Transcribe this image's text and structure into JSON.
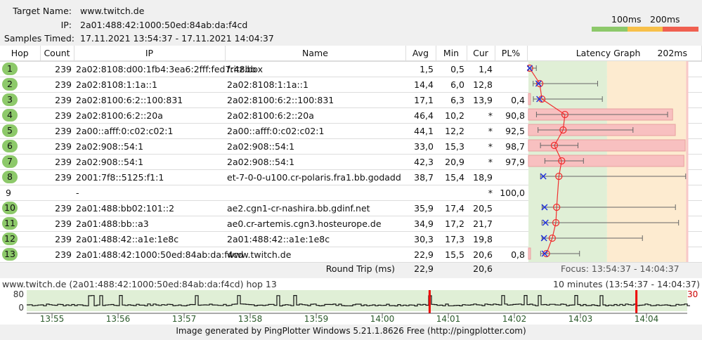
{
  "header": {
    "target_label": "Target Name:",
    "target": "www.twitch.de",
    "ip_label": "IP:",
    "ip": "2a01:488:42:1000:50ed:84ab:da:f4cd",
    "samples_label": "Samples Timed:",
    "samples": "17.11.2021 13:54:37 - 17.11.2021 14:04:37"
  },
  "legend": {
    "l1": "100ms",
    "l2": "200ms",
    "colors": [
      "#8dc96a",
      "#f8c04a",
      "#f06050"
    ]
  },
  "columns": {
    "hop": "Hop",
    "count": "Count",
    "ip": "IP",
    "name": "Name",
    "avg": "Avg",
    "min": "Min",
    "cur": "Cur",
    "pl": "PL%",
    "graph": "Latency Graph",
    "scale": "202ms"
  },
  "hops": [
    {
      "hop": "1",
      "count": "239",
      "ip": "2a02:8108:d00:1fb4:3ea6:2fff:fed7:48bb",
      "name": "fritz.box",
      "avg": "1,5",
      "min": "0,5",
      "cur": "1,4",
      "pl": "",
      "a": 1.5,
      "mn": 0.5,
      "c": 1.4,
      "mx": 10,
      "p": 0
    },
    {
      "hop": "2",
      "count": "239",
      "ip": "2a02:8108:1:1a::1",
      "name": "2a02:8108:1:1a::1",
      "avg": "14,4",
      "min": "6,0",
      "cur": "12,8",
      "pl": "",
      "a": 14.4,
      "mn": 6,
      "c": 12.8,
      "mx": 88,
      "p": 0
    },
    {
      "hop": "3",
      "count": "239",
      "ip": "2a02:8100:6:2::100:831",
      "name": "2a02:8100:6:2::100:831",
      "avg": "17,1",
      "min": "6,3",
      "cur": "13,9",
      "pl": "0,4",
      "a": 17.1,
      "mn": 6.3,
      "c": 13.9,
      "mx": 94,
      "p": 0.4
    },
    {
      "hop": "4",
      "count": "239",
      "ip": "2a02:8100:6:2::20a",
      "name": "2a02:8100:6:2::20a",
      "avg": "46,4",
      "min": "10,2",
      "cur": "*",
      "pl": "90,8",
      "a": 46.4,
      "mn": 10.2,
      "c": null,
      "mx": 177,
      "p": 90.8
    },
    {
      "hop": "5",
      "count": "239",
      "ip": "2a00::afff:0:c02:c02:1",
      "name": "2a00::afff:0:c02:c02:1",
      "avg": "44,1",
      "min": "12,2",
      "cur": "*",
      "pl": "92,5",
      "a": 44.1,
      "mn": 12.2,
      "c": null,
      "mx": 133,
      "p": 92.5
    },
    {
      "hop": "6",
      "count": "239",
      "ip": "2a02:908::54:1",
      "name": "2a02:908::54:1",
      "avg": "33,0",
      "min": "15,3",
      "cur": "*",
      "pl": "98,7",
      "a": 33,
      "mn": 15.3,
      "c": null,
      "mx": 63,
      "p": 98.7
    },
    {
      "hop": "7",
      "count": "239",
      "ip": "2a02:908::54:1",
      "name": "2a02:908::54:1",
      "avg": "42,3",
      "min": "20,9",
      "cur": "*",
      "pl": "97,9",
      "a": 42.3,
      "mn": 20.9,
      "c": null,
      "mx": 70,
      "p": 97.9
    },
    {
      "hop": "8",
      "count": "239",
      "ip": "2001:7f8::5125:f1:1",
      "name": "et-7-0-0-u100.cr-polaris.fra1.bb.godadd",
      "avg": "38,7",
      "min": "15,4",
      "cur": "18,9",
      "pl": "",
      "a": 38.7,
      "mn": 15.4,
      "c": 18.9,
      "mx": 200,
      "p": 0
    },
    {
      "hop": "9",
      "count": "",
      "ip": "-",
      "name": "",
      "avg": "",
      "min": "",
      "cur": "*",
      "pl": "100,0",
      "a": null,
      "mn": null,
      "c": null,
      "mx": null,
      "p": 0,
      "nobadge": true
    },
    {
      "hop": "10",
      "count": "239",
      "ip": "2a01:488:bb02:101::2",
      "name": "ae2.cgn1-cr-nashira.bb.gdinf.net",
      "avg": "35,9",
      "min": "17,4",
      "cur": "20,5",
      "pl": "",
      "a": 35.9,
      "mn": 17.4,
      "c": 20.5,
      "mx": 187,
      "p": 0
    },
    {
      "hop": "11",
      "count": "239",
      "ip": "2a01:488:bb::a3",
      "name": "ae0.cr-artemis.cgn3.hosteurope.de",
      "avg": "34,9",
      "min": "17,2",
      "cur": "21,7",
      "pl": "",
      "a": 34.9,
      "mn": 17.2,
      "c": 21.7,
      "mx": 191,
      "p": 0
    },
    {
      "hop": "12",
      "count": "239",
      "ip": "2a01:488:42::a1e:1e8c",
      "name": "2a01:488:42::a1e:1e8c",
      "avg": "30,3",
      "min": "17,3",
      "cur": "19,8",
      "pl": "",
      "a": 30.3,
      "mn": 17.3,
      "c": 19.8,
      "mx": 145,
      "p": 0
    },
    {
      "hop": "13",
      "count": "239",
      "ip": "2a01:488:42:1000:50ed:84ab:da:f4cd",
      "name": "www.twitch.de",
      "avg": "22,9",
      "min": "15,5",
      "cur": "20,6",
      "pl": "0,8",
      "a": 22.9,
      "mn": 15.5,
      "c": 20.6,
      "mx": 65,
      "p": 0.8
    }
  ],
  "summary": {
    "label": "Round Trip (ms)",
    "avg": "22,9",
    "cur": "20,6",
    "focus": "Focus: 13:54:37 - 14:04:37"
  },
  "timeline": {
    "title": "www.twitch.de (2a01:488:42:1000:50ed:84ab:da:f4cd) hop 13",
    "range": "10 minutes (13:54:37 - 14:04:37)",
    "y_top": "80",
    "y_bottom": "0",
    "right_label": "30",
    "ticks": [
      "13:55",
      "13:56",
      "13:57",
      "13:58",
      "13:59",
      "14:00",
      "14:01",
      "14:02",
      "14:03",
      "14:04"
    ],
    "loss_at_minutes": [
      6.1,
      9.23
    ]
  },
  "footer": "Image generated by PingPlotter Windows 5.21.1.8626 Free (http://pingplotter.com)"
}
